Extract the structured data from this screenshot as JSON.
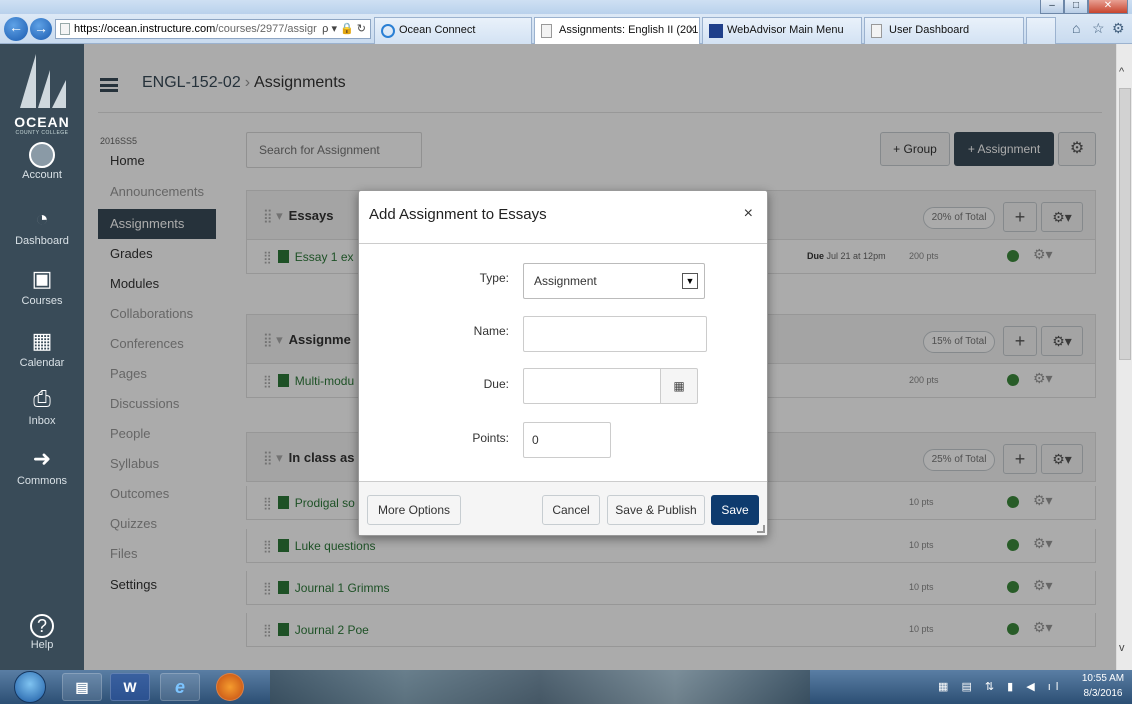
{
  "browser": {
    "url_domain": "https://ocean.instructure.com",
    "url_path": "/courses/2977/assigr",
    "url_tools": "ρ ▾ 🔒 ↻",
    "tabs": [
      {
        "label": "Ocean Connect"
      },
      {
        "label": "Assignments: English II (201...",
        "close": "×"
      },
      {
        "label": "WebAdvisor Main Menu"
      },
      {
        "label": "User Dashboard"
      }
    ]
  },
  "global_nav": {
    "logo": "OCEAN",
    "logo_sub": "COUNTY COLLEGE",
    "items": [
      {
        "label": "Account"
      },
      {
        "label": "Dashboard"
      },
      {
        "label": "Courses"
      },
      {
        "label": "Calendar"
      },
      {
        "label": "Inbox"
      },
      {
        "label": "Commons"
      },
      {
        "label": "Help"
      }
    ]
  },
  "breadcrumb": {
    "course": "ENGL-152-02",
    "separator": "›",
    "page": "Assignments"
  },
  "course_nav": {
    "term": "2016SS5",
    "items": [
      {
        "label": "Home"
      },
      {
        "label": "Announcements"
      },
      {
        "label": "Assignments"
      },
      {
        "label": "Grades"
      },
      {
        "label": "Modules"
      },
      {
        "label": "Collaborations"
      },
      {
        "label": "Conferences"
      },
      {
        "label": "Pages"
      },
      {
        "label": "Discussions"
      },
      {
        "label": "People"
      },
      {
        "label": "Syllabus"
      },
      {
        "label": "Outcomes"
      },
      {
        "label": "Quizzes"
      },
      {
        "label": "Files"
      },
      {
        "label": "Settings"
      }
    ]
  },
  "toolbar": {
    "search_placeholder": "Search for Assignment",
    "group_label": "+ Group",
    "assignment_label": "+ Assignment"
  },
  "groups": [
    {
      "title": "Essays",
      "weight": "20% of Total",
      "items": [
        {
          "title": "Essay 1 ex",
          "due": "Due",
          "due_date": "Jul 21 at 12pm",
          "points": "200 pts"
        }
      ]
    },
    {
      "title": "Assignme",
      "weight": "15% of Total",
      "items": [
        {
          "title": "Multi-modu",
          "due": "",
          "due_date": "",
          "points": "200 pts"
        }
      ]
    },
    {
      "title": "In class as",
      "weight": "25% of Total",
      "items": [
        {
          "title": "Prodigal so",
          "points": "10 pts"
        },
        {
          "title": "Luke questions",
          "points": "10 pts"
        },
        {
          "title": "Journal 1 Grimms",
          "points": "10 pts"
        },
        {
          "title": "Journal 2 Poe",
          "points": "10 pts"
        }
      ]
    }
  ],
  "dialog": {
    "title": "Add Assignment to Essays",
    "close": "×",
    "type_label": "Type:",
    "type_value": "Assignment",
    "name_label": "Name:",
    "due_label": "Due:",
    "points_label": "Points:",
    "points_value": "0",
    "more_options": "More Options",
    "cancel": "Cancel",
    "save_publish": "Save & Publish",
    "save": "Save"
  },
  "taskbar": {
    "time": "10:55 AM",
    "date": "8/3/2016"
  },
  "colors": {
    "nav_bg": "#394b58",
    "save_button": "#0e3b6e",
    "published_green": "#3c8a3c"
  }
}
